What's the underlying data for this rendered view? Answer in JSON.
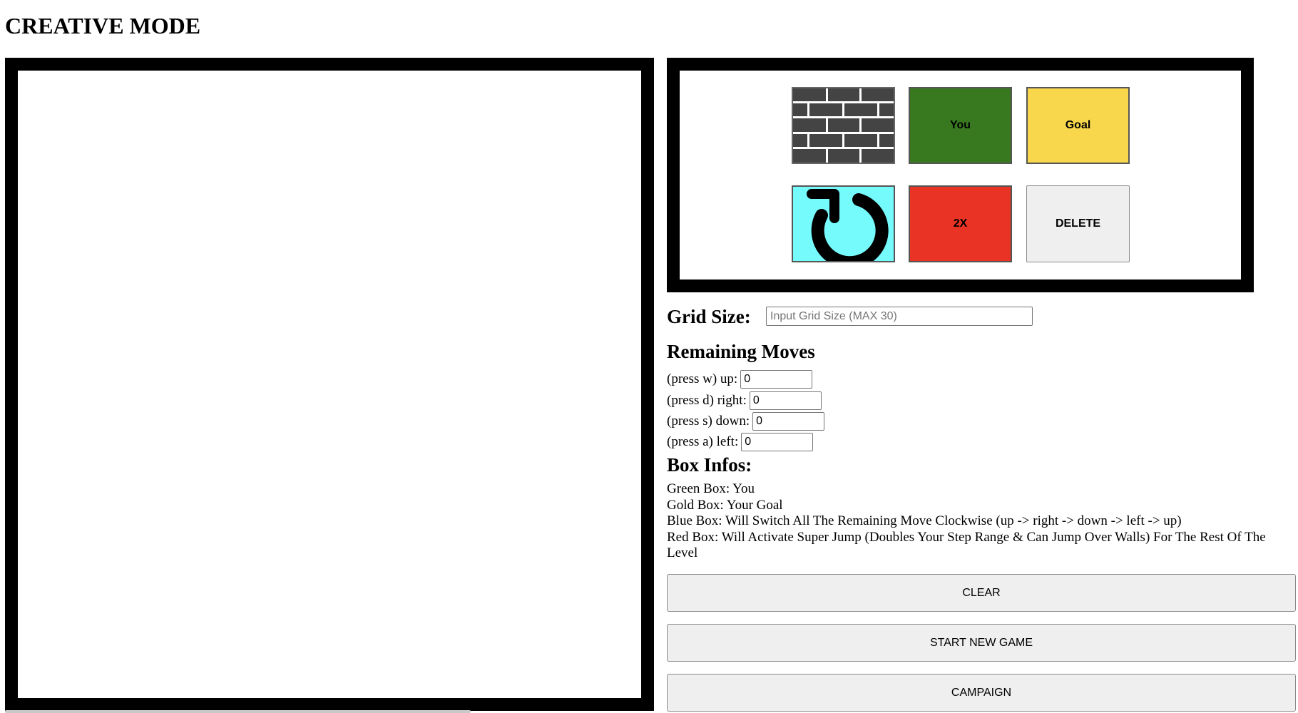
{
  "title": "CREATIVE MODE",
  "palette": {
    "wall_icon": "brick-wall-icon",
    "you_label": "You",
    "goal_label": "Goal",
    "rotate_icon": "clockwise-rotate-icon",
    "double_label": "2X",
    "delete_label": "DELETE",
    "colors": {
      "wall": "#444444",
      "you": "#38791f",
      "goal": "#f8d74c",
      "rotate": "#76fbfd",
      "double": "#e93324",
      "delete": "#efefef"
    }
  },
  "grid_size": {
    "label": "Grid Size:",
    "value": "",
    "placeholder": "Input Grid Size (MAX 30)"
  },
  "remaining_moves": {
    "heading": "Remaining Moves",
    "up": {
      "label": "(press w) up:",
      "value": "0"
    },
    "right": {
      "label": "(press d) right:",
      "value": "0"
    },
    "down": {
      "label": "(press s) down:",
      "value": "0"
    },
    "left": {
      "label": "(press a) left:",
      "value": "0"
    }
  },
  "box_infos": {
    "heading": "Box Infos:",
    "lines": [
      "Green Box: You",
      "Gold Box: Your Goal",
      "Blue Box: Will Switch All The Remaining Move Clockwise (up -> right -> down -> left -> up)",
      "Red Box: Will Activate Super Jump (Doubles Your Step Range & Can Jump Over Walls) For The Rest Of The Level"
    ]
  },
  "buttons": {
    "clear": "CLEAR",
    "new_game": "START NEW GAME",
    "campaign": "CAMPAIGN"
  }
}
